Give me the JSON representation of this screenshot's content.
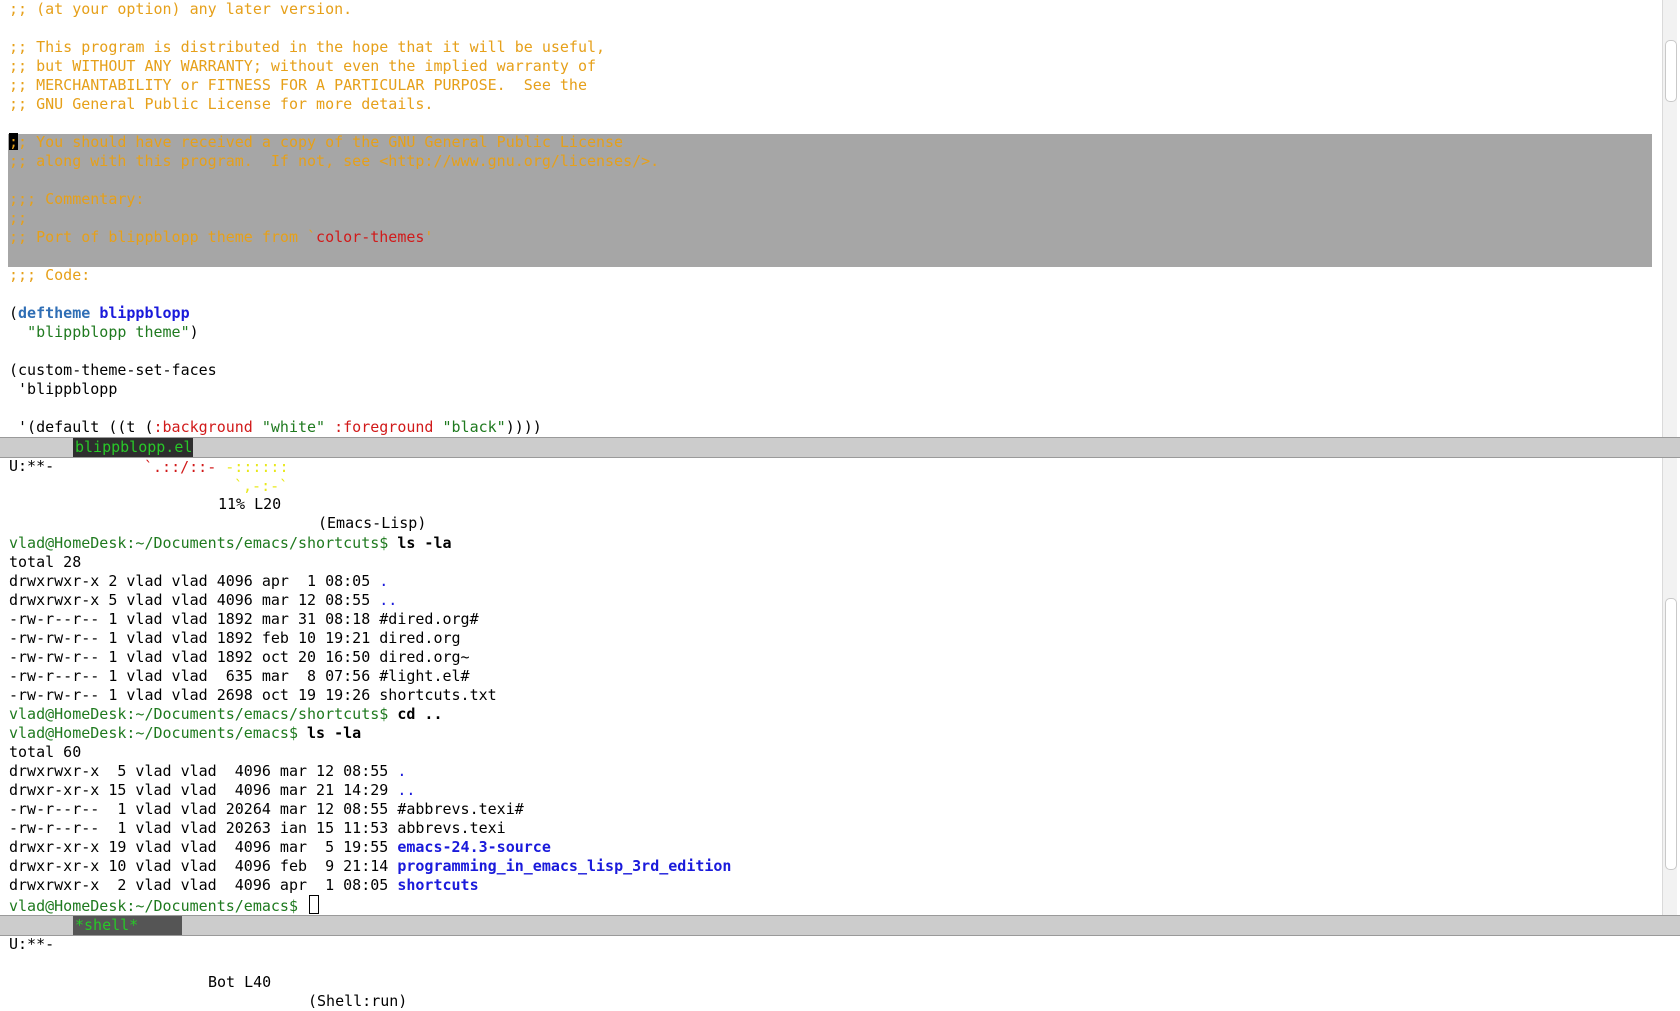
{
  "top_pane": {
    "lines": [
      {
        "cls": "cmt",
        "text": ";; (at your option) any later version."
      },
      {
        "cls": "cmt",
        "text": ""
      },
      {
        "cls": "cmt",
        "text": ";; This program is distributed in the hope that it will be useful,"
      },
      {
        "cls": "cmt",
        "text": ";; but WITHOUT ANY WARRANTY; without even the implied warranty of"
      },
      {
        "cls": "cmt",
        "text": ";; MERCHANTABILITY or FITNESS FOR A PARTICULAR PURPOSE.  See the"
      },
      {
        "cls": "cmt",
        "text": ";; GNU General Public License for more details."
      },
      {
        "cls": "cmt",
        "text": ""
      },
      {
        "cls": "cmt",
        "text": ";; You should have received a copy of the GNU General Public License"
      },
      {
        "cls": "cmt",
        "text": ";; along with this program.  If not, see <http://www.gnu.org/licenses/>."
      },
      {
        "cls": "cmt",
        "text": ""
      },
      {
        "cls": "cmt",
        "text": ";;; Commentary:"
      },
      {
        "cls": "cmt",
        "text": ";;"
      },
      {
        "cls": "cmt",
        "text": ";; Port of blippblopp theme from `"
      },
      {
        "cls": "cmt",
        "text": ""
      },
      {
        "cls": "cmt",
        "text": ";;; Code:"
      },
      {
        "cls": "",
        "text": ""
      },
      {
        "cls": "",
        "text": "("
      },
      {
        "cls": "",
        "text": "  "
      },
      {
        "cls": "",
        "text": ""
      },
      {
        "cls": "",
        "text": "(custom-theme-set-faces"
      },
      {
        "cls": "",
        "text": " 'blippblopp"
      },
      {
        "cls": "",
        "text": ""
      },
      {
        "cls": "",
        "text": " '(default ((t ("
      }
    ],
    "commentary_symbol": "color-themes",
    "commentary_tail": "'",
    "deftheme_keyword": "deftheme",
    "theme_name": "blippblopp",
    "theme_doc": "\"blippblopp theme\"",
    "theme_doc_close": ")",
    "face_bg_key": ":background",
    "face_bg_val": "\"white\"",
    "face_fg_key": ":foreground",
    "face_fg_val": "\"black\"",
    "face_close": "))))",
    "first_region_char": ";"
  },
  "top_modeline": {
    "status": "U:**-",
    "buffer": "blippblopp.el",
    "position": "11% L20",
    "mode": "(Emacs-Lisp)"
  },
  "bottom_pane": {
    "art_line1_red": "`.::/::- ",
    "art_line1_yellow": "-::::::",
    "art_line2_yellow": "`,-:-`",
    "prompt1": "vlad@HomeDesk:~/Documents/emacs/shortcuts$ ",
    "cmd1": "ls -la",
    "total1": "total 28",
    "listing1": [
      {
        "meta": "drwxrwxr-x 2 vlad vlad 4096 apr  1 08:05 ",
        "name": ".",
        "cls": "dotdir"
      },
      {
        "meta": "drwxrwxr-x 5 vlad vlad 4096 mar 12 08:55 ",
        "name": "..",
        "cls": "dotdir"
      },
      {
        "meta": "-rw-r--r-- 1 vlad vlad 1892 mar 31 08:18 ",
        "name": "#dired.org#",
        "cls": ""
      },
      {
        "meta": "-rw-rw-r-- 1 vlad vlad 1892 feb 10 19:21 ",
        "name": "dired.org",
        "cls": ""
      },
      {
        "meta": "-rw-rw-r-- 1 vlad vlad 1892 oct 20 16:50 ",
        "name": "dired.org~",
        "cls": ""
      },
      {
        "meta": "-rw-r--r-- 1 vlad vlad  635 mar  8 07:56 ",
        "name": "#light.el#",
        "cls": ""
      },
      {
        "meta": "-rw-rw-r-- 1 vlad vlad 2698 oct 19 19:26 ",
        "name": "shortcuts.txt",
        "cls": ""
      }
    ],
    "prompt2": "vlad@HomeDesk:~/Documents/emacs/shortcuts$ ",
    "cmd2": "cd ..",
    "prompt3": "vlad@HomeDesk:~/Documents/emacs$ ",
    "cmd3": "ls -la",
    "total2": "total 60",
    "listing2": [
      {
        "meta": "drwxrwxr-x  5 vlad vlad  4096 mar 12 08:55 ",
        "name": ".",
        "cls": "dotdir"
      },
      {
        "meta": "drwxr-xr-x 15 vlad vlad  4096 mar 21 14:29 ",
        "name": "..",
        "cls": "dotdir"
      },
      {
        "meta": "-rw-r--r--  1 vlad vlad 20264 mar 12 08:55 ",
        "name": "#abbrevs.texi#",
        "cls": ""
      },
      {
        "meta": "-rw-r--r--  1 vlad vlad 20263 ian 15 11:53 ",
        "name": "abbrevs.texi",
        "cls": ""
      },
      {
        "meta": "drwxr-xr-x 19 vlad vlad  4096 mar  5 19:55 ",
        "name": "emacs-24.3-source",
        "cls": "dir"
      },
      {
        "meta": "drwxr-xr-x 10 vlad vlad  4096 feb  9 21:14 ",
        "name": "programming_in_emacs_lisp_3rd_edition",
        "cls": "dir"
      },
      {
        "meta": "drwxrwxr-x  2 vlad vlad  4096 apr  1 08:05 ",
        "name": "shortcuts",
        "cls": "dir"
      }
    ],
    "prompt4": "vlad@HomeDesk:~/Documents/emacs$ "
  },
  "bottom_modeline": {
    "status": "U:**-",
    "buffer": "*shell*",
    "position": "Bot L40",
    "mode": "(Shell:run)"
  },
  "colors": {
    "comment": "#e6a01a",
    "string": "#1f7a1f",
    "keyword": "#2f6eb5",
    "function": "#1a1adb",
    "region": "#a6a6a6",
    "modeline": "#cccccc"
  }
}
